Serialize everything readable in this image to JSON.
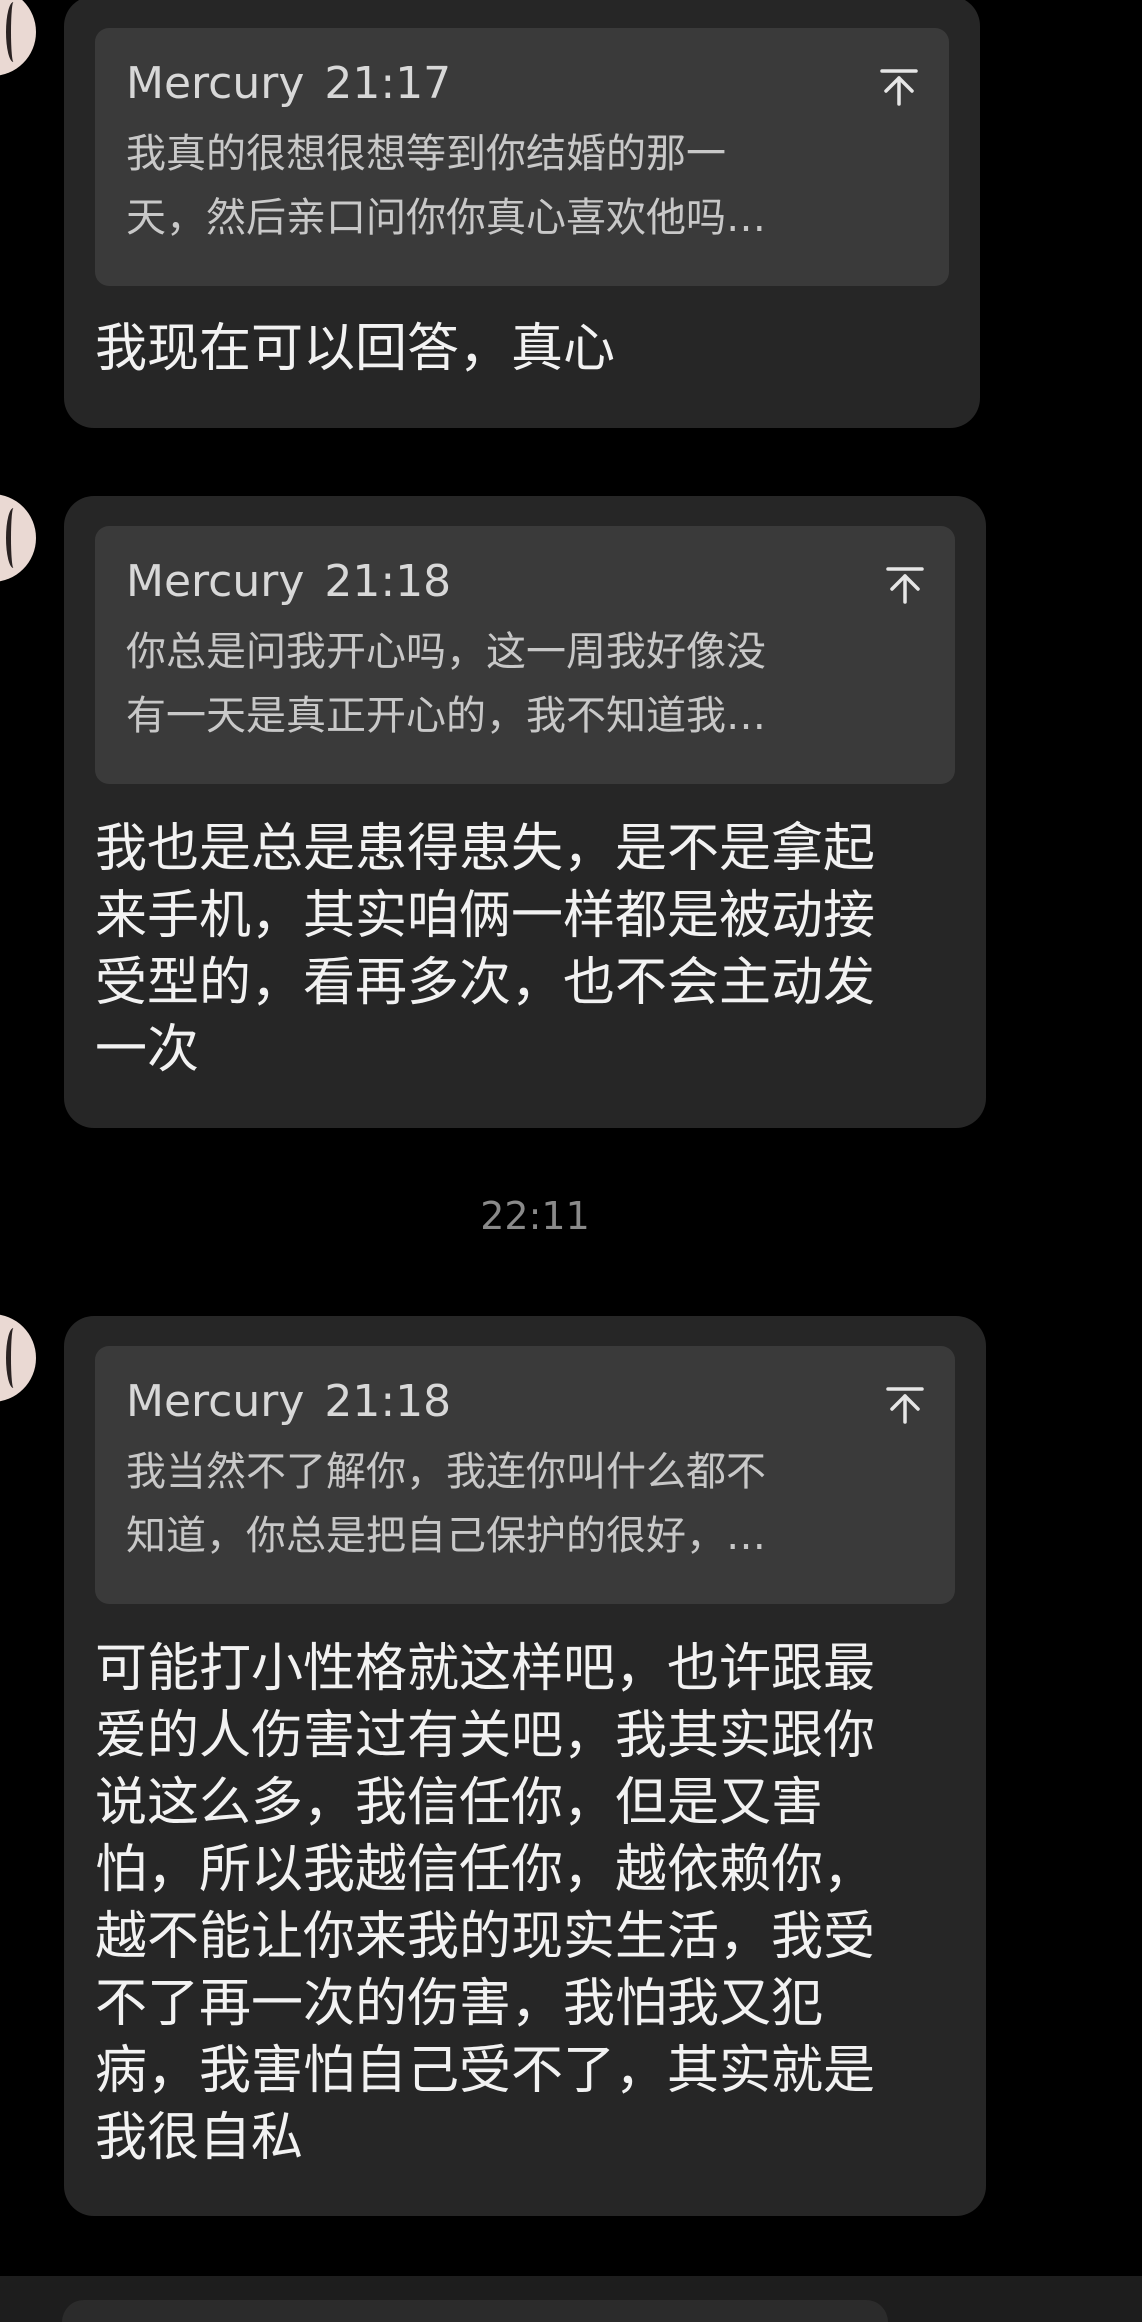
{
  "messages": [
    {
      "quote": {
        "name": "Mercury",
        "time": "21:17",
        "text": "我真的很想很想等到你结婚的那一\n天，然后亲口问你你真心喜欢他吗…"
      },
      "text": "我现在可以回答，真心"
    },
    {
      "quote": {
        "name": "Mercury",
        "time": "21:18",
        "text": "你总是问我开心吗，这一周我好像没\n有一天是真正开心的，我不知道我…"
      },
      "text": "我也是总是患得患失，是不是拿起\n来手机，其实咱俩一样都是被动接\n受型的，看再多次，也不会主动发\n一次"
    },
    {
      "quote": {
        "name": "Mercury",
        "time": "21:18",
        "text": "我当然不了解你，我连你叫什么都不\n知道，你总是把自己保护的很好，…"
      },
      "text": "可能打小性格就这样吧，也许跟最\n爱的人伤害过有关吧，我其实跟你\n说这么多，我信任你，但是又害\n怕，所以我越信任你，越依赖你，\n越不能让你来我的现实生活，我受\n不了再一次的伤害，我怕我又犯\n病，我害怕自己受不了，其实就是\n我很自私"
    }
  ],
  "time_divider": "22:11",
  "icons": {
    "avatar": "contact-avatar",
    "quote_jump": "jump-to-top-icon"
  },
  "colors": {
    "background": "#000000",
    "bubble": "#262626",
    "quote_box": "#3a3a3a",
    "message_text": "#f2f2f2",
    "divider_text": "#8a8a8a"
  }
}
